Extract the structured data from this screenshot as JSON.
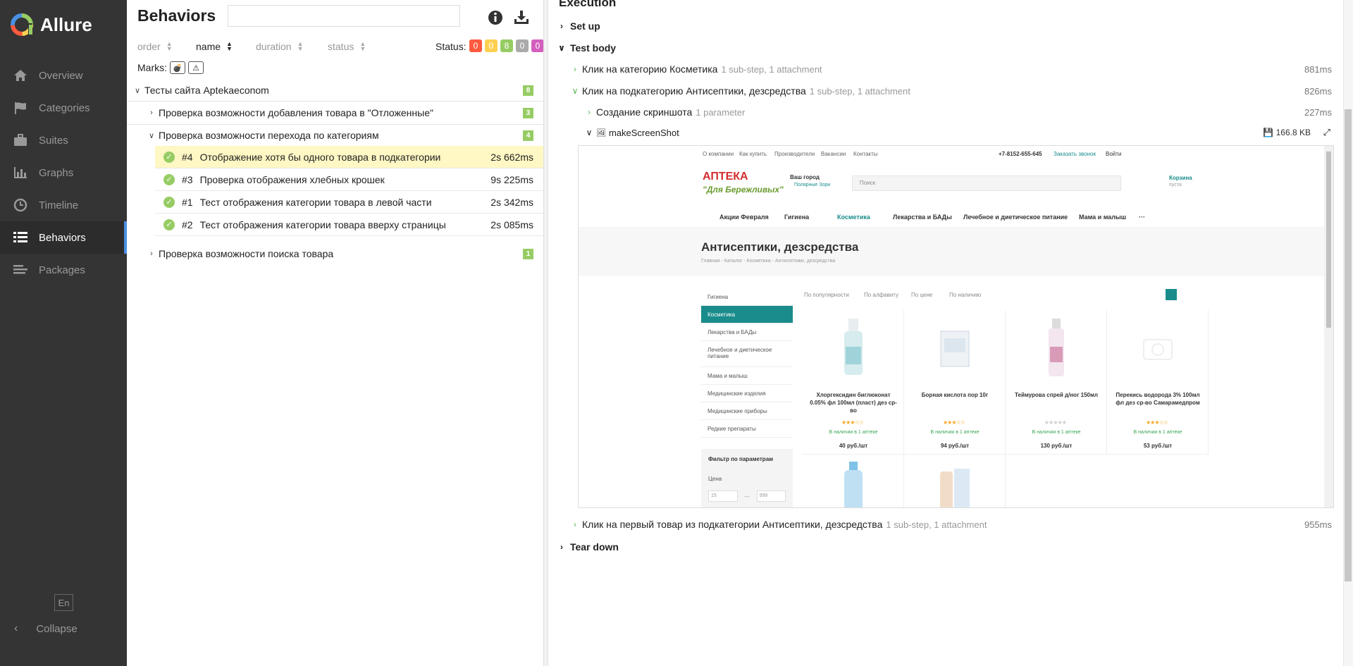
{
  "app": {
    "name": "Allure"
  },
  "sidebar": {
    "items": [
      {
        "label": "Overview",
        "icon": "home-icon"
      },
      {
        "label": "Categories",
        "icon": "flag-icon"
      },
      {
        "label": "Suites",
        "icon": "briefcase-icon"
      },
      {
        "label": "Graphs",
        "icon": "bar-chart-icon"
      },
      {
        "label": "Timeline",
        "icon": "clock-icon"
      },
      {
        "label": "Behaviors",
        "icon": "list-icon"
      },
      {
        "label": "Packages",
        "icon": "stack-icon"
      }
    ],
    "active": "Behaviors",
    "lang": "En",
    "collapse": "Collapse"
  },
  "behaviors": {
    "title": "Behaviors",
    "sort": {
      "order": "order",
      "name": "name",
      "duration": "duration",
      "status": "status"
    },
    "status_label": "Status:",
    "status_counts": [
      {
        "value": "0",
        "color": "#fd5a3e"
      },
      {
        "value": "0",
        "color": "#ffd050"
      },
      {
        "value": "8",
        "color": "#97cc64"
      },
      {
        "value": "0",
        "color": "#aaaaaa"
      },
      {
        "value": "0",
        "color": "#d35ebe"
      }
    ],
    "marks_label": "Marks:",
    "root": {
      "label": "Тесты сайта Aptekaeconom",
      "count": "8"
    },
    "features": [
      {
        "label": "Проверка возможности добавления товара в \"Отложенные\"",
        "count": "3"
      },
      {
        "label": "Проверка возможности перехода по категориям",
        "count": "4"
      },
      {
        "label": "Проверка возможности поиска товара",
        "count": "1"
      }
    ],
    "tests": [
      {
        "num": "#4",
        "name": "Отображение хотя бы одного товара в подкатегории",
        "duration": "2s 662ms"
      },
      {
        "num": "#3",
        "name": "Проверка отображения хлебных крошек",
        "duration": "9s 225ms"
      },
      {
        "num": "#1",
        "name": "Тест отображения категории товара в левой части",
        "duration": "2s 342ms"
      },
      {
        "num": "#2",
        "name": "Тест отображения категории товара вверху страницы",
        "duration": "2s 085ms"
      }
    ]
  },
  "execution": {
    "title": "Execution",
    "setup": "Set up",
    "body": "Test body",
    "teardown": "Tear down",
    "steps": [
      {
        "name": "Клик на категорию Косметика",
        "meta": "1 sub-step, 1 attachment",
        "time": "881ms"
      },
      {
        "name": "Клик на подкатегорию Антисептики, дезсредства",
        "meta": "1 sub-step, 1 attachment",
        "time": "826ms"
      },
      {
        "name": "Создание скриншота",
        "meta": "1 parameter",
        "time": "227ms"
      },
      {
        "name": "Клик на первый товар из подкатегории Антисептики, дезсредства",
        "meta": "1 sub-step, 1 attachment",
        "time": "955ms"
      }
    ],
    "attachment": {
      "name": "makeScreenShot",
      "size": "166.8 KB"
    }
  },
  "screenshot": {
    "top_links": [
      "О компании",
      "Как купить",
      "Производители",
      "Вакансии",
      "Контакты"
    ],
    "phone": "+7-8152-655-645",
    "callback": "Заказать звонок",
    "login": "Войти",
    "logo": "АПТЕКА",
    "slogan": "\"Для Бережливых\"",
    "city": "Ваш город",
    "city_value": "Полярные Зори",
    "search_placeholder": "Поиск",
    "cart": "Корзина",
    "cart_state": "пуста",
    "menu": [
      "Акции Февраля",
      "Гигиена",
      "Косметика",
      "Лекарства и БАДы",
      "Лечебное и диетическое питание",
      "Мама и малыш",
      "···"
    ],
    "heading": "Антисептики, дезсредства",
    "breadcrumb": "Главная - Каталог - Косметика - Антисептики, дезсредства",
    "categories": [
      "Гигиена",
      "Косметика",
      "Лекарства и БАДы",
      "Лечебное и диетическое питание",
      "Мама и малыш",
      "Медицинские изделия",
      "Медицинские приборы",
      "Редкие препараты"
    ],
    "sort_options": [
      "По популярности",
      "По алфавиту",
      "По цене",
      "По наличию"
    ],
    "products": [
      {
        "name": "Хлоргексидин биглюконат 0.05% фл 100мл (пласт) дез ср-во",
        "price": "40 руб./шт",
        "avail": "В наличии в 1 аптеке"
      },
      {
        "name": "Борная кислота пор 10г",
        "price": "94 руб./шт",
        "avail": "В наличии в 1 аптеке"
      },
      {
        "name": "Теймурова спрей д/ног 150мл",
        "price": "130 руб./шт",
        "avail": "В наличии в 1 аптеке"
      },
      {
        "name": "Перекись водорода 3% 100мл фл дез ср-во Самарамедпром",
        "price": "53 руб./шт",
        "avail": "В наличии в 1 аптеке"
      }
    ],
    "filter_title": "Фильтр по параметрам",
    "filter_price": "Цена",
    "price_min": "15",
    "price_max": "999"
  }
}
